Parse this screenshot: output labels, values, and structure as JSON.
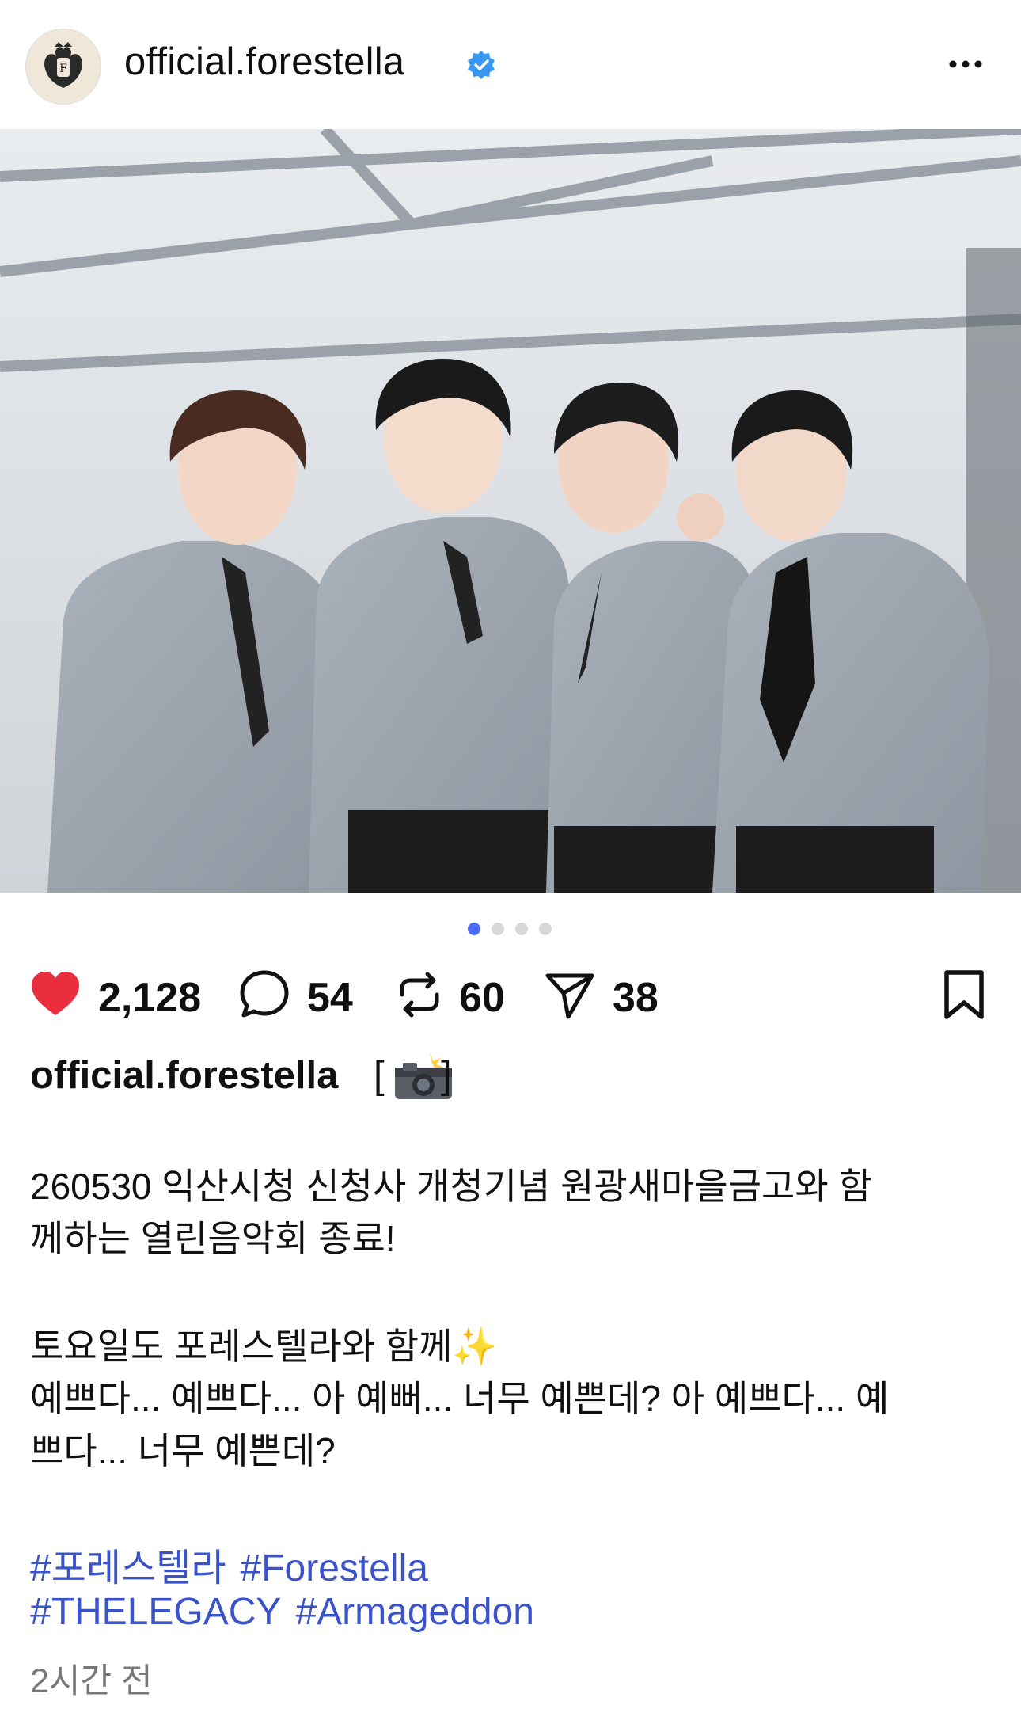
{
  "header": {
    "username": "official.forestella",
    "verified_icon": "verified-badge-icon",
    "more_icon": "more-horizontal-icon"
  },
  "carousel": {
    "total": 4,
    "active": 0,
    "active_color": "#4b6bfb"
  },
  "actions": {
    "likes": "2,128",
    "comments": "54",
    "reposts": "60",
    "shares": "38",
    "like_color": "#ea2d3f"
  },
  "caption": {
    "username": "official.forestella",
    "bracket_open": "[",
    "bracket_close": "]",
    "line1": "260530 익산시청 신청사 개청기념 원광새마을금고와 함",
    "line2": "께하는 열린음악회 종료!",
    "line3": "토요일도 포레스텔라와 함께✨",
    "line4": "예쁘다... 예쁘다... 아 예뻐... 너무 예쁜데? 아 예쁘다... 예",
    "line5": "쁘다... 너무 예쁜데?",
    "hashtags_row1": [
      "#포레스텔라",
      "#Forestella"
    ],
    "hashtags_row2": [
      "#THELEGACY",
      "#Armageddon"
    ],
    "hashtag_color": "#3b53c8"
  },
  "timestamp": "2시간 전"
}
